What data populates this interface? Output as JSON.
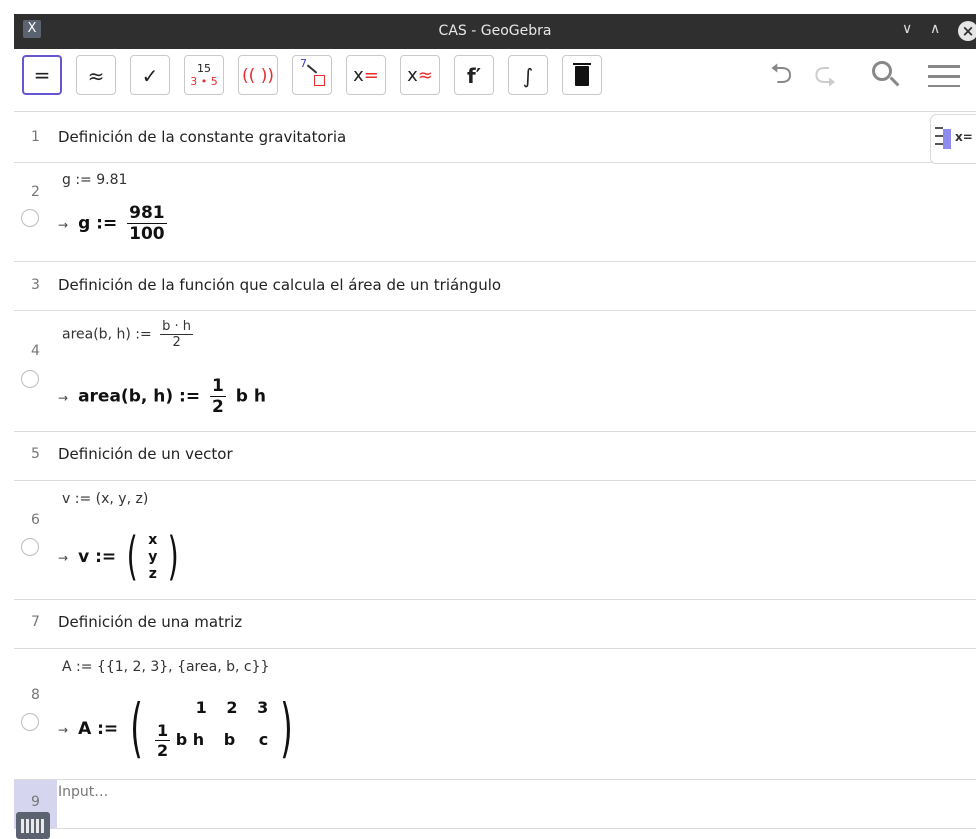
{
  "window": {
    "title": "CAS - GeoGebra",
    "app_icon": "X"
  },
  "toolbar": {
    "buttons": [
      {
        "name": "evaluate",
        "label": "="
      },
      {
        "name": "numeric",
        "label": "≈"
      },
      {
        "name": "keep-input",
        "label": "✓"
      },
      {
        "name": "factor",
        "top": "15",
        "bottom": "3 • 5"
      },
      {
        "name": "expand",
        "label": "(( ))"
      },
      {
        "name": "substitute",
        "label": "7"
      },
      {
        "name": "solve",
        "label": "x",
        "suffix": "="
      },
      {
        "name": "solve-numerically",
        "label": "x",
        "suffix": "≈"
      },
      {
        "name": "derivative",
        "label": "f′"
      },
      {
        "name": "integral",
        "label": "∫"
      },
      {
        "name": "delete",
        "label": "🗑"
      }
    ]
  },
  "rows": [
    {
      "num": "1",
      "text": "Definición de la constante gravitatoria"
    },
    {
      "num": "2",
      "input": "g := 9.81",
      "out_var": "g :=",
      "out_num": "981",
      "out_den": "100"
    },
    {
      "num": "3",
      "text": "Definición de la función que calcula el área de un triángulo"
    },
    {
      "num": "4",
      "input_lhs": "area(b, h) :=",
      "input_num": "b · h",
      "input_den": "2",
      "out_lhs": "area(b, h)  :=",
      "out_num": "1",
      "out_den": "2",
      "out_rest": "b h"
    },
    {
      "num": "5",
      "text": "Definición de un vector"
    },
    {
      "num": "6",
      "input": "v := (x, y, z)",
      "out_lhs": "v :=",
      "vector": [
        "x",
        "y",
        "z"
      ]
    },
    {
      "num": "7",
      "text": "Definición de una matriz"
    },
    {
      "num": "8",
      "input": "A := {{1, 2, 3}, {area, b, c}}",
      "out_lhs": "A :=",
      "matrix_row1": [
        "1",
        "2",
        "3"
      ],
      "matrix_r2_num": "1",
      "matrix_r2_den": "2",
      "matrix_r2_rest": "b h",
      "matrix_row2": [
        "b",
        "c"
      ]
    },
    {
      "num": "9",
      "placeholder": "Input…"
    }
  ],
  "side_button": {
    "label": "x="
  }
}
